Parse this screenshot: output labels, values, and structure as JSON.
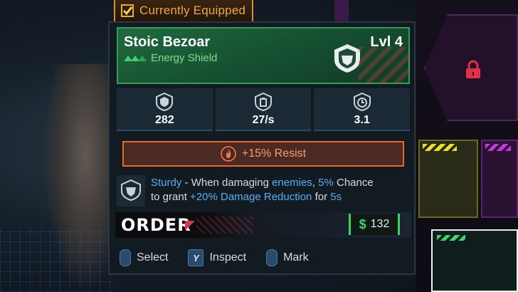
{
  "equipped": {
    "label": "Currently Equipped",
    "icon": "check-icon"
  },
  "item": {
    "name": "Stoic Bezoar",
    "level": "Lvl 4",
    "type": "Energy Shield",
    "rarity_color": "#3ed46a",
    "badge_icon": "shield-face-icon"
  },
  "stats": [
    {
      "icon": "shield-capacity-icon",
      "value": "282"
    },
    {
      "icon": "recharge-rate-icon",
      "value": "27/s"
    },
    {
      "icon": "recharge-delay-icon",
      "value": "3.1"
    }
  ],
  "resist": {
    "icon": "fire-icon",
    "text": "+15% Resist",
    "color": "#e56a2a"
  },
  "perk": {
    "icon": "sturdy-perk-icon",
    "name": "Sturdy",
    "sep1": " - When damaging ",
    "target": "enemies",
    "sep2": ", ",
    "chance": "5%",
    "sep3": " Chance",
    "line2_prefix": "to grant ",
    "bonus": "+20% Damage Reduction",
    "line2_mid": " for ",
    "duration": "5s"
  },
  "manufacturer": {
    "name": "ORDER"
  },
  "price": {
    "currency_icon": "$",
    "amount": "132"
  },
  "actions": [
    {
      "glyph": "",
      "label": "Select"
    },
    {
      "glyph": "Y",
      "label": "Inspect"
    },
    {
      "glyph": "",
      "label": "Mark"
    }
  ]
}
